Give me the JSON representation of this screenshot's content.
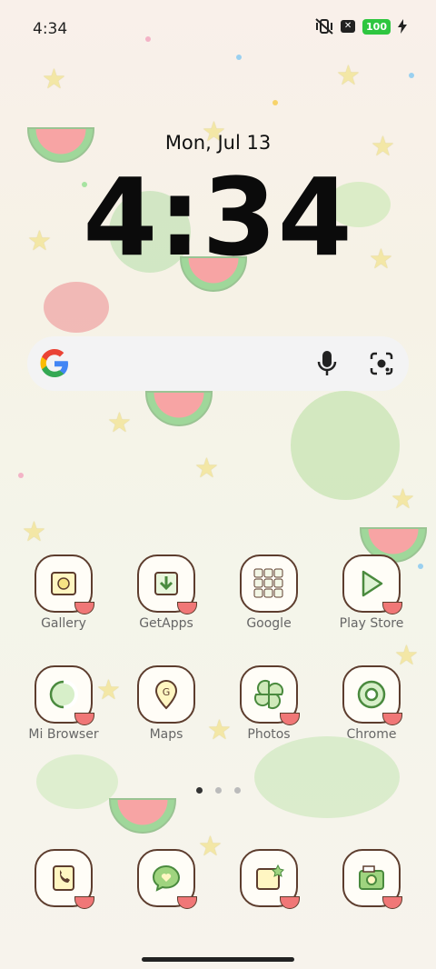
{
  "status_bar": {
    "time": "4:34",
    "battery": "100"
  },
  "clock": {
    "date": "Mon, Jul 13",
    "time": "4:34"
  },
  "search_bar": {
    "logo": "google-g-icon",
    "mic": "mic-icon",
    "lens": "lens-icon"
  },
  "apps": {
    "row1": [
      {
        "label": "Gallery"
      },
      {
        "label": "GetApps"
      },
      {
        "label": "Google"
      },
      {
        "label": "Play Store"
      }
    ],
    "row2": [
      {
        "label": "Mi Browser"
      },
      {
        "label": "Maps"
      },
      {
        "label": "Photos"
      },
      {
        "label": "Chrome"
      }
    ]
  },
  "dock": [
    "phone-icon",
    "messages-icon",
    "notes-icon",
    "camera-icon"
  ],
  "page_indicator": {
    "count": 3,
    "active": 1
  },
  "colors": {
    "accent_green": "#2ec640",
    "icon_border": "#5d3d2e",
    "melon_red": "#f07777"
  }
}
